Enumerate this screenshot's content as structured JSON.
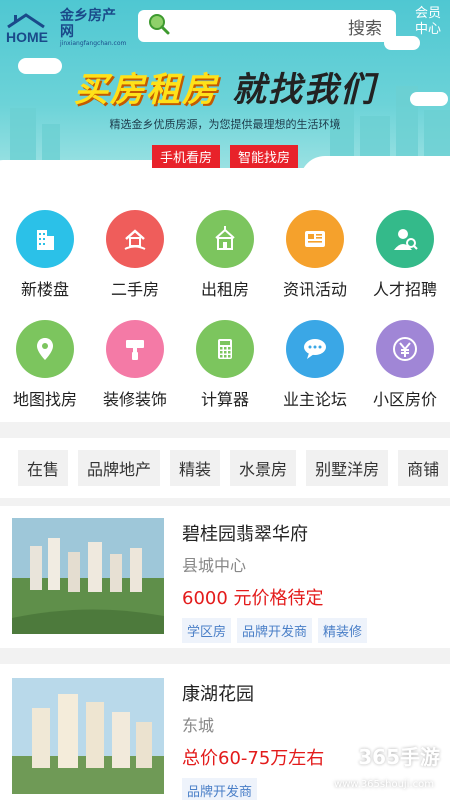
{
  "header": {
    "logo_text": "金乡房产网",
    "logo_en": "jinxiangfangchan.com",
    "logo_home": "HOME",
    "search_placeholder": "搜索",
    "member_line1": "会员",
    "member_line2": "中心"
  },
  "banner": {
    "slogan_part1": "买房租房",
    "slogan_part2": "就找我们",
    "subtitle": "精选金乡优质房源，为您提供最理想的生活环境",
    "tag1": "手机看房",
    "tag2": "智能找房"
  },
  "categories": [
    {
      "label": "新楼盘",
      "color": "#2bc1e8",
      "icon": "building-icon"
    },
    {
      "label": "二手房",
      "color": "#ef5d5b",
      "icon": "house-hand-icon"
    },
    {
      "label": "出租房",
      "color": "#7cc55e",
      "icon": "rental-building-icon"
    },
    {
      "label": "资讯活动",
      "color": "#f5a12c",
      "icon": "news-icon"
    },
    {
      "label": "人才招聘",
      "color": "#34ba8a",
      "icon": "recruit-person-icon"
    },
    {
      "label": "地图找房",
      "color": "#7cc55e",
      "icon": "map-pin-icon"
    },
    {
      "label": "装修装饰",
      "color": "#f47aa6",
      "icon": "paint-roller-icon"
    },
    {
      "label": "计算器",
      "color": "#7cc55e",
      "icon": "calculator-icon"
    },
    {
      "label": "业主论坛",
      "color": "#3aa7e6",
      "icon": "chat-bubble-icon"
    },
    {
      "label": "小区房价",
      "color": "#a086d6",
      "icon": "yuan-coin-icon"
    }
  ],
  "filters": [
    "在售",
    "品牌地产",
    "精装",
    "水景房",
    "别墅洋房",
    "商铺"
  ],
  "listings": [
    {
      "title": "碧桂园翡翠华府",
      "area": "县城中心",
      "price": "6000 元价格待定",
      "tags": [
        "学区房",
        "品牌开发商",
        "精装修"
      ]
    },
    {
      "title": "康湖花园",
      "area": "东城",
      "price": "总价60-75万左右",
      "tags": [
        "品牌开发商"
      ]
    }
  ],
  "watermark": {
    "text": "365手游",
    "url": "www.365shouji.com"
  }
}
